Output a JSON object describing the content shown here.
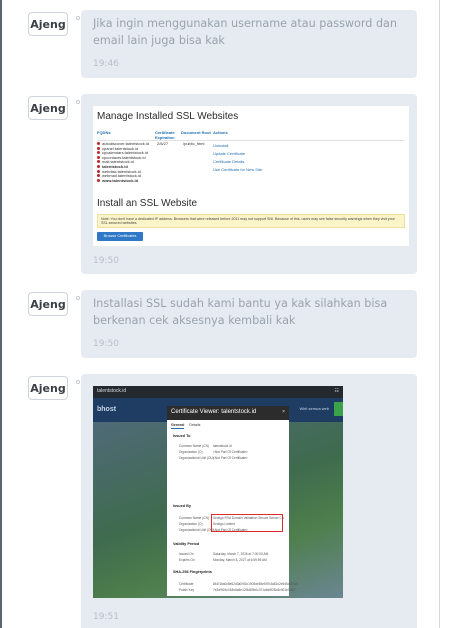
{
  "sender": "Ajeng",
  "messages": [
    {
      "text": "Jika ingin menggunakan username atau password dan email lain juga bisa kak",
      "time": "19:46"
    },
    {
      "time": "19:50"
    },
    {
      "text": "Installasi SSL sudah kami bantu ya kak silahkan bisa berkenan cek aksesnya kembali kak",
      "time": "19:50"
    },
    {
      "time": "19:51"
    }
  ],
  "ssl_screenshot": {
    "title": "Manage Installed SSL Websites",
    "col_fqdn": "FQDNs",
    "col_exp": "Certificate Expiration",
    "col_root": "Document Root",
    "col_actions": "Actions",
    "domains": [
      "autodiscover.talentstock.id",
      "cpanel.talentstock.id",
      "cpcalendars.talentstock.id",
      "cpcontacts.talentstock.id",
      "mail.talentstock.id",
      "talentstock.id",
      "webdisk.talentstock.id",
      "webmail.talentstock.id",
      "www.talentstock.id"
    ],
    "expiration": "2/6/27",
    "doc_root": "/public_html",
    "actions": [
      "Uninstall",
      "Update Certificate",
      "Certificate Details",
      "Use Certificate for New Site"
    ],
    "install_title": "Install an SSL Website",
    "note": "Note: You don't have a dedicated IP address. Browsers that were released before 2011 may not support SNI. Because of this, users may see false security warnings when they visit your SSL secured websites.",
    "browse_button": "Browse Certificates"
  },
  "cert_screenshot": {
    "tab_title": "talentstock.id",
    "brand": "bhost",
    "nav_text": "Wirit semua web",
    "modal_title": "Certificate Viewer: talentstock.id",
    "close_glyph": "×",
    "tabs": [
      "General",
      "Details"
    ],
    "issued_to_label": "Issued To",
    "issued_to": [
      {
        "k": "Common Name (CN)",
        "v": "talentstock.id"
      },
      {
        "k": "Organization (O)",
        "v": "<Not Part Of Certificate>"
      },
      {
        "k": "Organizational Unit (OU)",
        "v": "<Not Part Of Certificate>"
      }
    ],
    "issued_by_label": "Issued By",
    "issued_by": [
      {
        "k": "Common Name (CN)",
        "v": "Sectigo RSA Domain Validation Secure Server CA"
      },
      {
        "k": "Organization (O)",
        "v": "Sectigo Limited"
      },
      {
        "k": "Organizational Unit (OU)",
        "v": "<Not Part Of Certificate>"
      }
    ],
    "validity_label": "Validity Period",
    "validity": [
      {
        "k": "Issued On",
        "v": "Saturday, March 7, 2026 at 7:00:00 AM"
      },
      {
        "k": "Expires On",
        "v": "Monday, March 8, 2027 at 6:59:59 AM"
      }
    ],
    "fingerprints_label": "SHA-256 Fingerprints",
    "fingerprints": [
      {
        "k": "Certificate",
        "v": "8b1f16a0c8e62d3a09f2c1905de84e5f7b3a81c2e946d0f7ab"
      },
      {
        "k": "Public Key",
        "v": "7e3d9f24c018b6a5e12f4d89b0c371a6e5f28d4c901b7e63"
      }
    ]
  },
  "colors": {
    "bubble": "#e6ebf1",
    "text": "#9aa3ad",
    "highlight": "#e02a2a"
  }
}
